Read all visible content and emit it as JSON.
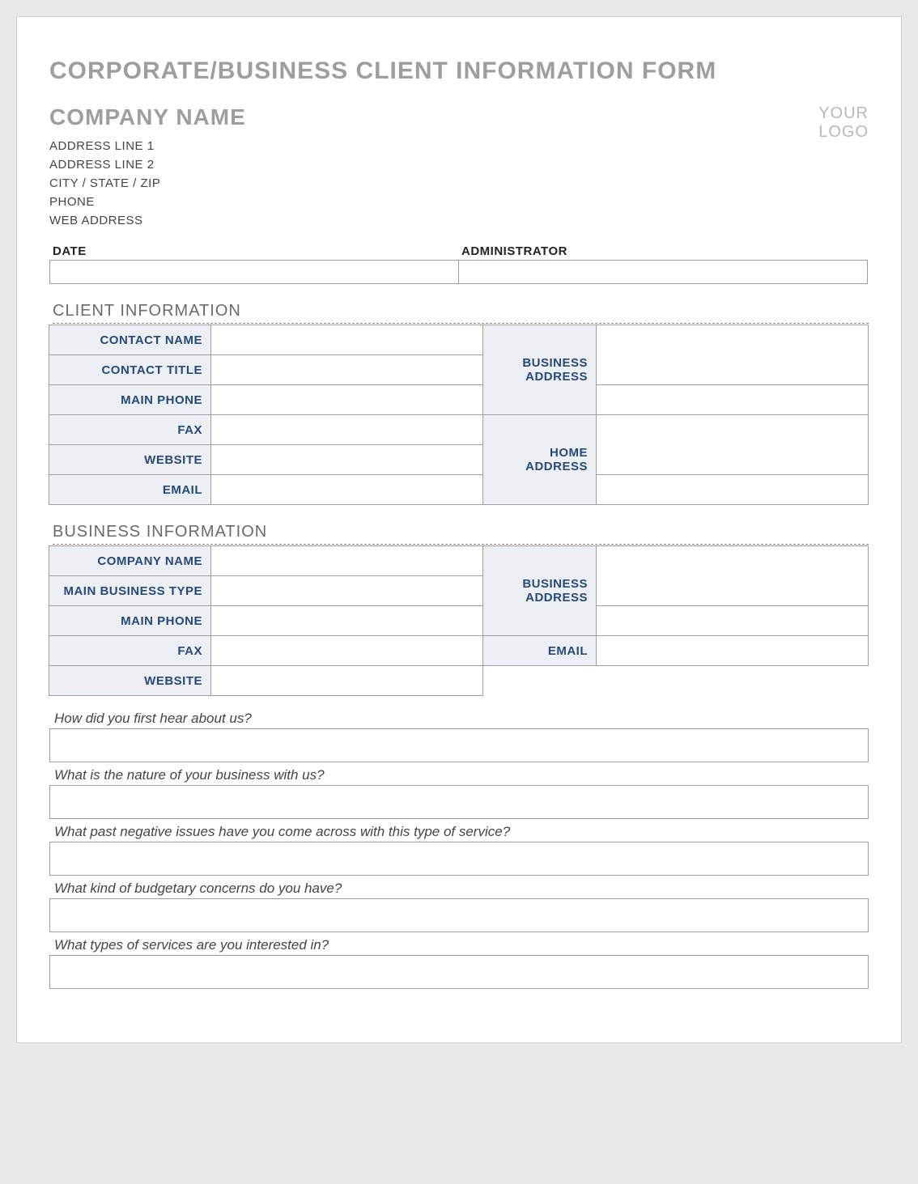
{
  "title": "CORPORATE/BUSINESS CLIENT INFORMATION FORM",
  "company": {
    "name": "COMPANY NAME",
    "lines": [
      "ADDRESS LINE 1",
      "ADDRESS LINE 2",
      "CITY / STATE / ZIP",
      "PHONE",
      "WEB ADDRESS"
    ]
  },
  "logo": {
    "l1": "YOUR",
    "l2": "LOGO"
  },
  "meta": {
    "date_lbl": "DATE",
    "admin_lbl": "ADMINISTRATOR",
    "date_val": "",
    "admin_val": ""
  },
  "sections": {
    "client": "CLIENT INFORMATION",
    "business": "BUSINESS INFORMATION"
  },
  "client": {
    "contact_name": "CONTACT NAME",
    "contact_title": "CONTACT TITLE",
    "main_phone": "MAIN PHONE",
    "fax": "FAX",
    "website": "WEBSITE",
    "email": "EMAIL",
    "biz_addr": "BUSINESS ADDRESS",
    "home_addr": "HOME ADDRESS"
  },
  "business": {
    "company_name": "COMPANY NAME",
    "main_type": "MAIN BUSINESS TYPE",
    "main_phone": "MAIN PHONE",
    "fax": "FAX",
    "website": "WEBSITE",
    "biz_addr": "BUSINESS ADDRESS",
    "email": "EMAIL"
  },
  "questions": {
    "q1": "How did you first hear about us?",
    "q2": "What is the nature of your business with us?",
    "q3": "What past negative issues have you come across with this type of service?",
    "q4": "What kind of budgetary concerns do you have?",
    "q5": "What types of services are you interested in?"
  }
}
